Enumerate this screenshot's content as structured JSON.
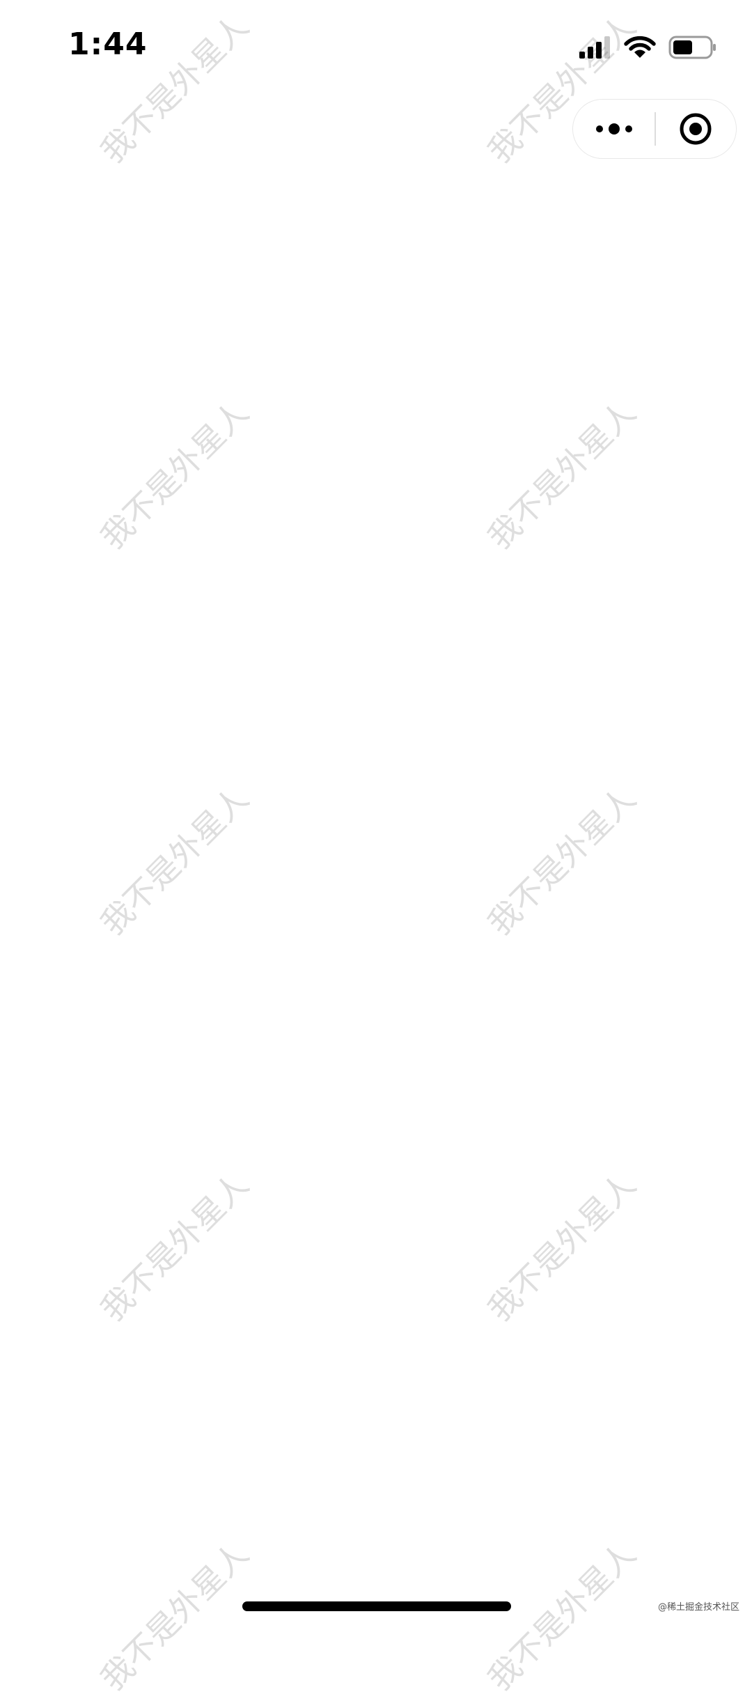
{
  "status_bar": {
    "time": "1:44",
    "icons": [
      "signal-icon",
      "wifi-icon",
      "battery-icon"
    ],
    "battery_level": 0.5
  },
  "capsule": {
    "more_icon": "more-dots-icon",
    "close_icon": "target-close-icon"
  },
  "watermark": {
    "text": "我不是外星人"
  },
  "footer": {
    "credit": "@稀土掘金技术社区"
  }
}
